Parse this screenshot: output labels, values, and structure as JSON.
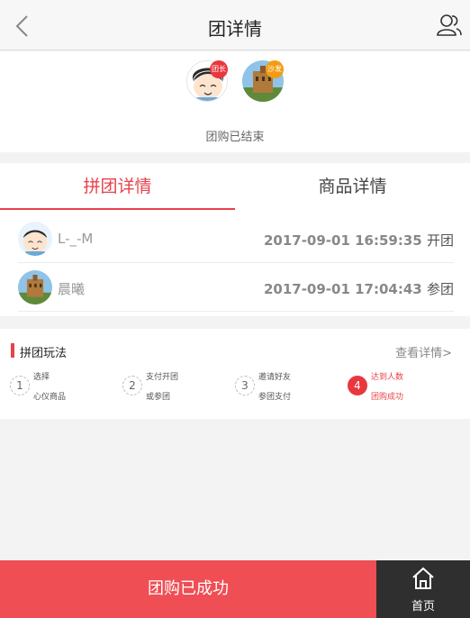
{
  "header": {
    "title": "团详情",
    "back_icon": "chevron-left-icon",
    "users_icon": "users-icon"
  },
  "group": {
    "leader_badge": "团长",
    "sofa_badge": "沙发",
    "status": "团购已结束"
  },
  "tabs": [
    {
      "label": "拼团详情",
      "active": true
    },
    {
      "label": "商品详情",
      "active": false
    }
  ],
  "members": [
    {
      "name": "L-_-M",
      "time": "2017-09-01 16:59:35",
      "action": "开团"
    },
    {
      "name": "晨曦",
      "time": "2017-09-01 17:04:43",
      "action": "参团"
    }
  ],
  "rules": {
    "title": "拼团玩法",
    "more": "查看详情>",
    "steps": [
      {
        "num": "1",
        "line1": "选择",
        "line2": "心仪商品"
      },
      {
        "num": "2",
        "line1": "支付开团",
        "line2": "或参团"
      },
      {
        "num": "3",
        "line1": "邀请好友",
        "line2": "参团支付"
      },
      {
        "num": "4",
        "line1": "达到人数",
        "line2": "团购成功"
      }
    ]
  },
  "bottom": {
    "main_label": "团购已成功",
    "home_label": "首页",
    "home_icon": "home-icon"
  },
  "colors": {
    "accent": "#e8424a",
    "button": "#ef4e54",
    "home_bg": "#2f2f2f"
  }
}
